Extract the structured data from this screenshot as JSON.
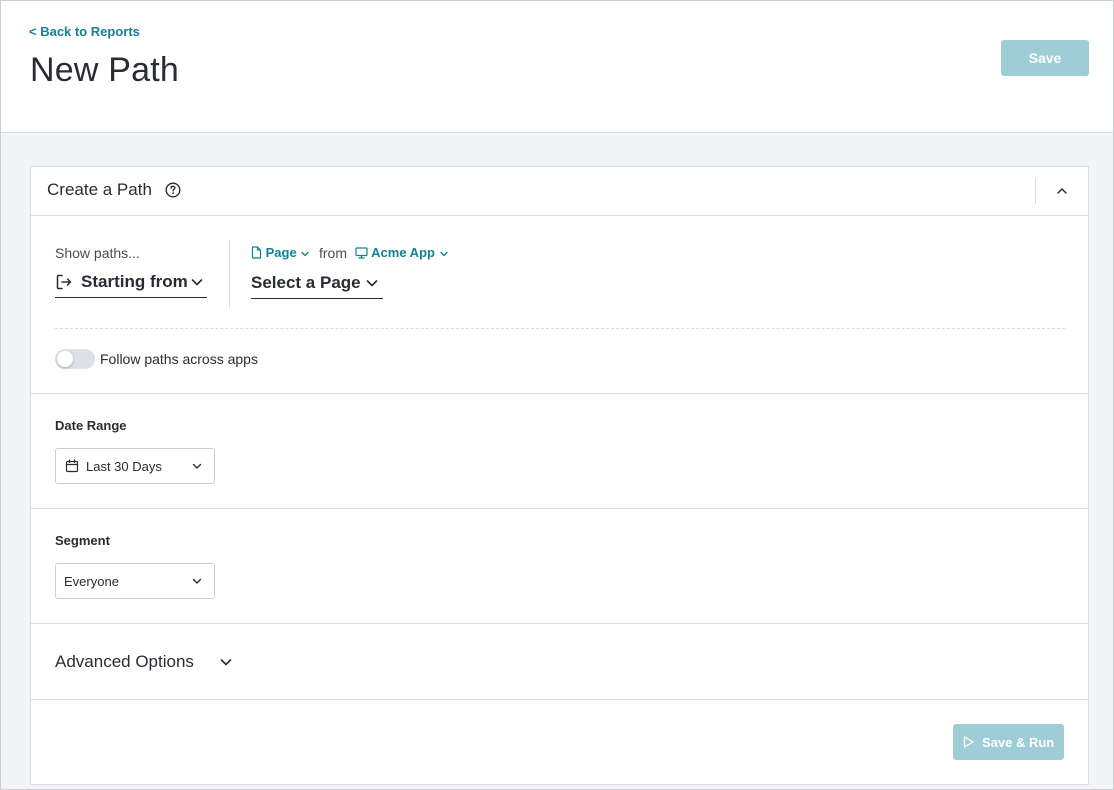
{
  "header": {
    "back_link": "< Back to Reports",
    "title": "New Path",
    "save_label": "Save"
  },
  "card": {
    "title": "Create a Path",
    "show_paths_label": "Show paths...",
    "direction_value": "Starting from",
    "source_type": "Page",
    "from_text": "from",
    "app_name": "Acme App",
    "page_select_placeholder": "Select a Page",
    "follow_toggle_label": "Follow paths across apps",
    "follow_toggle_on": false,
    "date_range": {
      "label": "Date Range",
      "value": "Last 30 Days"
    },
    "segment": {
      "label": "Segment",
      "value": "Everyone"
    },
    "advanced_label": "Advanced Options",
    "run_label": "Save & Run"
  },
  "colors": {
    "accent": "#128297",
    "disabled_button": "#9fcdd7",
    "border": "#d8dde4",
    "page_background": "#f3f4f6"
  },
  "icons": [
    "question-circle-icon",
    "chevron-up-icon",
    "sign-out-icon",
    "chevron-down-icon",
    "file-icon",
    "monitor-icon",
    "calendar-icon",
    "play-icon"
  ]
}
